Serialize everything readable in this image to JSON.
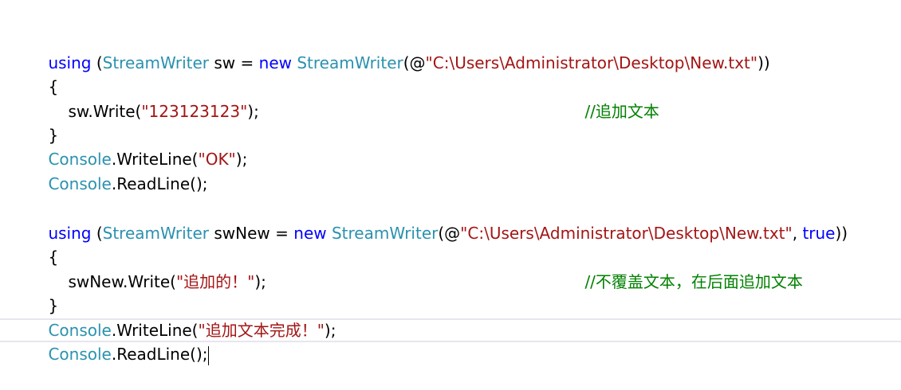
{
  "colors": {
    "keyword": "#0000ff",
    "type": "#2b91af",
    "string": "#a31515",
    "comment": "#008000",
    "current_line_border": "#e6e6ef"
  },
  "code": {
    "block1": {
      "using_kw": "using",
      "open_paren": " (",
      "type1": "StreamWriter",
      "var_decl": " sw = ",
      "new_kw": "new",
      "space": " ",
      "type2": "StreamWriter",
      "arg_open": "(@",
      "path": "\"C:\\Users\\Administrator\\Desktop\\New.txt\"",
      "close": "))",
      "brace_open": "{",
      "stmt_pre": "sw.Write(",
      "stmt_str": "\"123123123\"",
      "stmt_post": ");",
      "comment": "//追加文本",
      "brace_close": "}",
      "console1_type": "Console",
      "console1_call": ".WriteLine(",
      "console1_str": "\"OK\"",
      "console1_post": ");",
      "console2_type": "Console",
      "console2_call": ".ReadLine();"
    },
    "block2": {
      "using_kw": "using",
      "open_paren": " (",
      "type1": "StreamWriter",
      "var_decl": " swNew = ",
      "new_kw": "new",
      "space": " ",
      "type2": "StreamWriter",
      "arg_open": "(@",
      "path": "\"C:\\Users\\Administrator\\Desktop\\New.txt\"",
      "comma": ", ",
      "true_kw": "true",
      "close": "))",
      "brace_open": "{",
      "stmt_pre": "swNew.Write(",
      "stmt_str": "\"追加的！\"",
      "stmt_post": ");",
      "comment": "//不覆盖文本，在后面追加文本",
      "brace_close": "}",
      "console1_type": "Console",
      "console1_call": ".WriteLine(",
      "console1_str": "\"追加文本完成！\"",
      "console1_post": ");",
      "console2_type": "Console",
      "console2_call": ".ReadLine();"
    }
  }
}
